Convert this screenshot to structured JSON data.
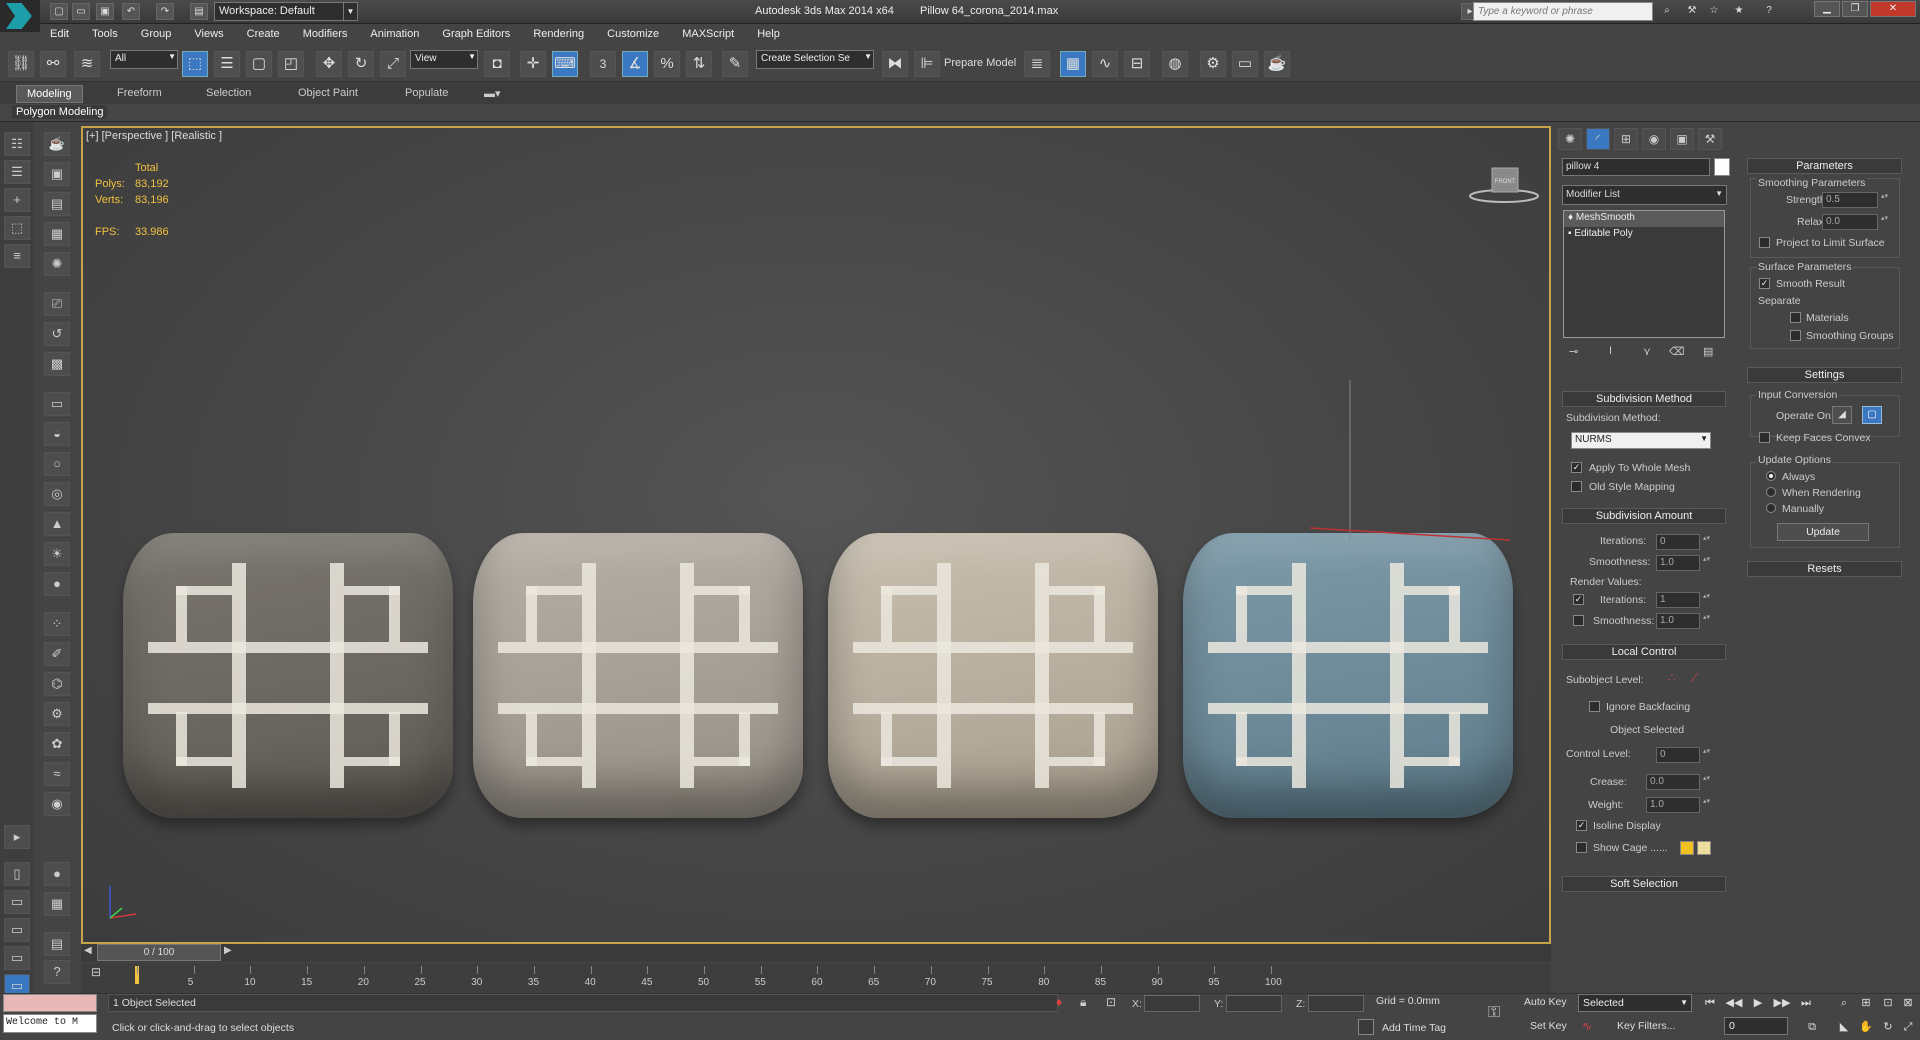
{
  "titlebar": {
    "workspace": "Workspace: Default",
    "app_title": "Autodesk 3ds Max  2014 x64",
    "file_title": "Pillow 64_corona_2014.max",
    "search_placeholder": "Type a keyword or phrase"
  },
  "menu": [
    "Edit",
    "Tools",
    "Group",
    "Views",
    "Create",
    "Modifiers",
    "Animation",
    "Graph Editors",
    "Rendering",
    "Customize",
    "MAXScript",
    "Help"
  ],
  "toolbar": {
    "selection_filter": "All",
    "ref_coord": "View",
    "named_selection": "Create Selection Se",
    "prepare_model": "Prepare Model",
    "snap_label": "3"
  },
  "ribbon": {
    "tabs": [
      "Modeling",
      "Freeform",
      "Selection",
      "Object Paint",
      "Populate"
    ],
    "panel_label": "Polygon Modeling"
  },
  "viewport": {
    "label": "[+] [Perspective ] [Realistic ]",
    "stats": {
      "header": "Total",
      "polys_label": "Polys:",
      "polys": "83,192",
      "verts_label": "Verts:",
      "verts": "83,196",
      "fps_label": "FPS:",
      "fps": "33.986"
    },
    "viewcube_label": "FRONT",
    "pillow_colors": [
      "#6f6b66",
      "#a8a298",
      "#bdb3a3",
      "#6f8d9c"
    ]
  },
  "command_panel": {
    "object_name": "pillow 4",
    "modifier_list": "Modifier List",
    "stack": [
      "MeshSmooth",
      "Editable Poly"
    ],
    "subdivision_method": {
      "title": "Subdivision Method",
      "method_label": "Subdivision Method:",
      "method_value": "NURMS",
      "apply_whole_mesh": "Apply To Whole Mesh",
      "old_style": "Old Style Mapping"
    },
    "subdivision_amount": {
      "title": "Subdivision Amount",
      "iterations_label": "Iterations:",
      "iterations": "0",
      "smoothness_label": "Smoothness:",
      "smoothness": "1.0",
      "render_values": "Render Values:",
      "r_iterations": "1",
      "r_smoothness": "1.0"
    },
    "local_control": {
      "title": "Local Control",
      "subobject_level": "Subobject Level:",
      "ignore_backfacing": "Ignore Backfacing",
      "object_selected": "Object Selected",
      "control_level_label": "Control Level:",
      "control_level": "0",
      "crease_label": "Crease:",
      "crease": "0.0",
      "weight_label": "Weight:",
      "weight": "1.0",
      "isoline_display": "Isoline Display",
      "show_cage": "Show Cage ......"
    },
    "soft_selection": "Soft Selection",
    "parameters": {
      "title": "Parameters",
      "smoothing_params": "Smoothing Parameters",
      "strength_label": "Strength:",
      "strength": "0.5",
      "relax_label": "Relax:",
      "relax": "0.0",
      "project_limit": "Project to Limit Surface",
      "surface_params": "Surface Parameters",
      "smooth_result": "Smooth Result",
      "separate": "Separate",
      "materials": "Materials",
      "smoothing_groups": "Smoothing Groups"
    },
    "settings": {
      "title": "Settings",
      "input_conversion": "Input Conversion",
      "operate_on": "Operate On:",
      "keep_faces_convex": "Keep Faces Convex",
      "update_options": "Update Options",
      "always": "Always",
      "when_rendering": "When Rendering",
      "manually": "Manually",
      "update": "Update"
    },
    "resets": "Resets"
  },
  "timeline": {
    "slider": "0 / 100",
    "ticks": [
      "5",
      "10",
      "15",
      "20",
      "25",
      "30",
      "35",
      "40",
      "45",
      "50",
      "55",
      "60",
      "65",
      "70",
      "75",
      "80",
      "85",
      "90",
      "95",
      "100"
    ]
  },
  "status": {
    "welcome": "Welcome to M",
    "selected_count": "1 Object Selected",
    "prompt": "Click or click-and-drag to select objects",
    "x_label": "X:",
    "y_label": "Y:",
    "z_label": "Z:",
    "grid": "Grid = 0.0mm",
    "add_time_tag": "Add Time Tag",
    "auto_key": "Auto Key",
    "set_key": "Set Key",
    "selected_dropdown": "Selected",
    "key_filters": "Key Filters...",
    "frame": "0"
  }
}
